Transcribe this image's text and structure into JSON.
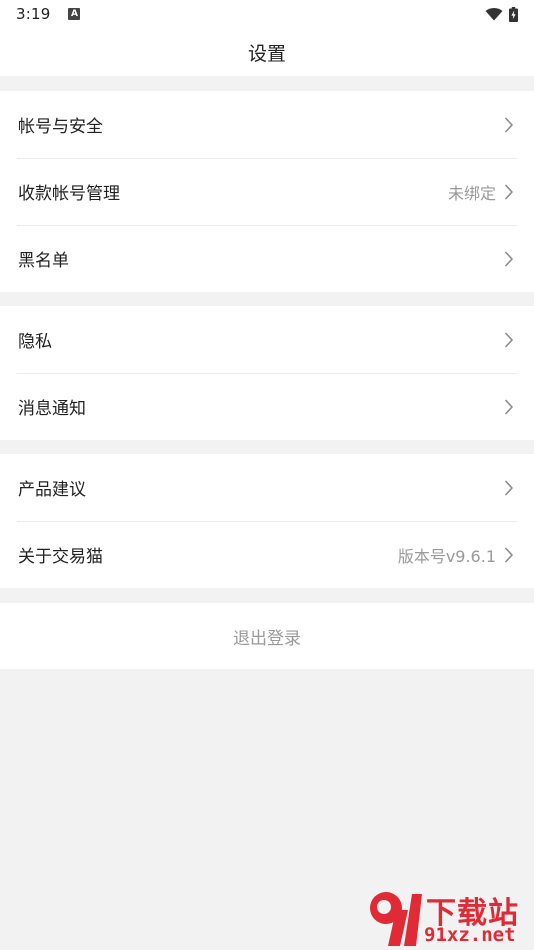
{
  "status_bar": {
    "time": "3:19",
    "notification_letter": "A"
  },
  "header": {
    "title": "设置"
  },
  "groups": [
    {
      "items": [
        {
          "label": "帐号与安全",
          "value": ""
        },
        {
          "label": "收款帐号管理",
          "value": "未绑定"
        },
        {
          "label": "黑名单",
          "value": ""
        }
      ]
    },
    {
      "items": [
        {
          "label": "隐私",
          "value": ""
        },
        {
          "label": "消息通知",
          "value": ""
        }
      ]
    },
    {
      "items": [
        {
          "label": "产品建议",
          "value": ""
        },
        {
          "label": "关于交易猫",
          "value": "版本号v9.6.1"
        }
      ]
    }
  ],
  "logout": {
    "label": "退出登录"
  },
  "watermark": {
    "top_text": "下载站",
    "bottom_text": "91xz.net"
  },
  "colors": {
    "background": "#f2f2f2",
    "card": "#ffffff",
    "text_primary": "#222222",
    "text_secondary": "#9a9a9a",
    "chevron": "#8c8c8c",
    "watermark_red": "#e02a36"
  },
  "icons": {
    "row_arrow": "chevron-right-icon",
    "wifi": "wifi-icon",
    "battery": "battery-charging-icon"
  }
}
